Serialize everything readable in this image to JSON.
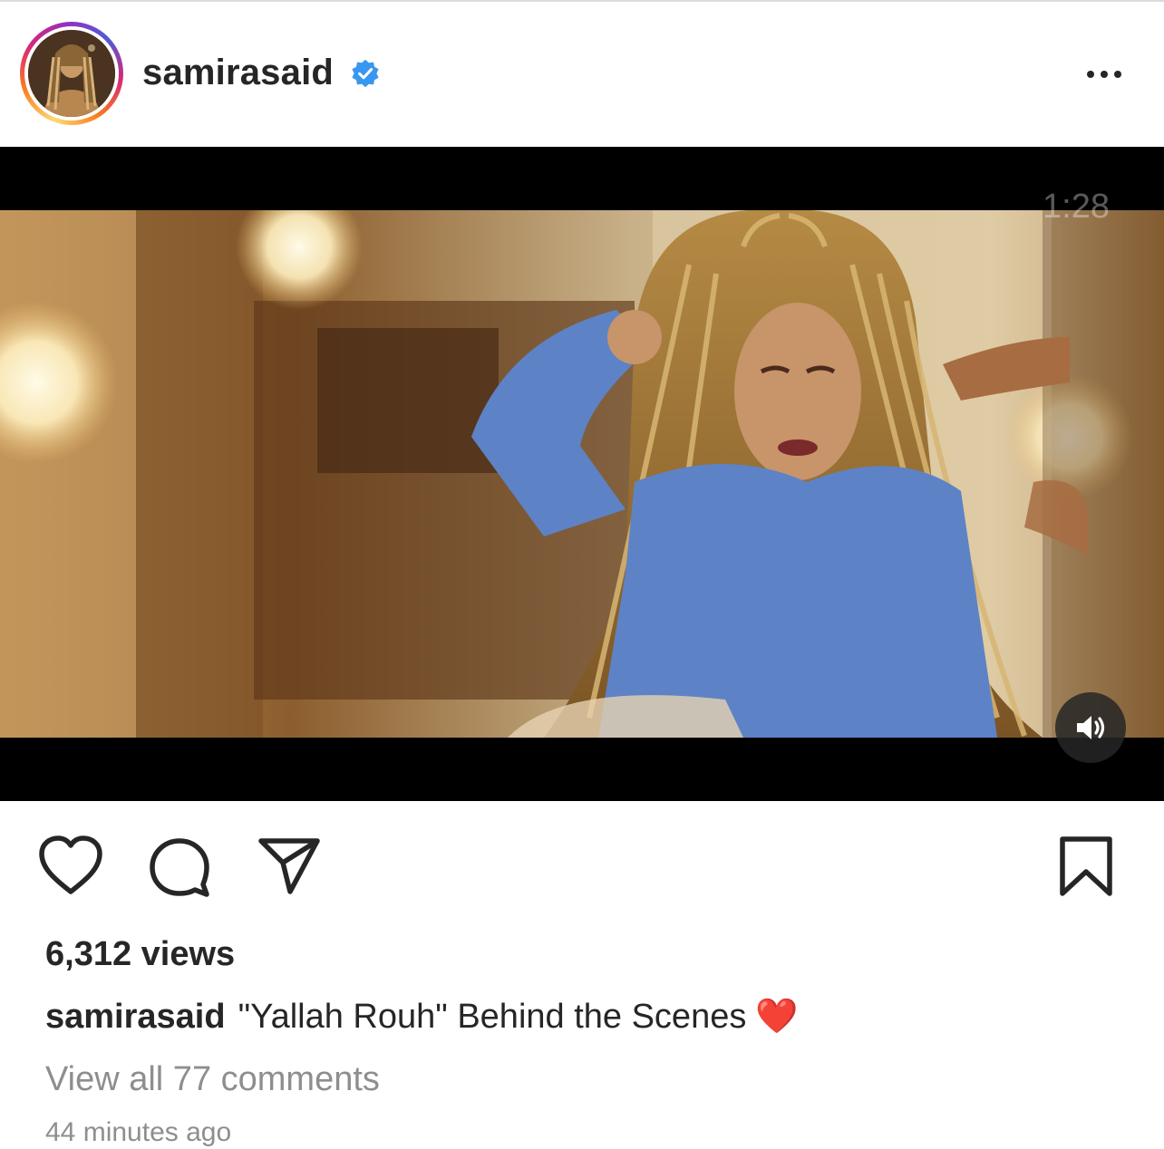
{
  "post": {
    "username": "samirasaid",
    "verified": true,
    "more_icon": "more-horizontal-icon"
  },
  "video": {
    "duration": "1:28",
    "mute_icon": "speaker-on-icon"
  },
  "actions": {
    "like_icon": "heart-outline-icon",
    "comment_icon": "comment-bubble-icon",
    "share_icon": "paper-plane-icon",
    "save_icon": "bookmark-outline-icon"
  },
  "stats": {
    "views": "6,312 views"
  },
  "caption": {
    "username": "samirasaid",
    "text": "\"Yallah Rouh\" Behind the Scenes",
    "emoji": "❤️"
  },
  "comments": {
    "view_all": "View all 77 comments"
  },
  "timestamp": "44 minutes ago",
  "colors": {
    "verified_blue": "#3897f0",
    "text_primary": "#262626",
    "text_secondary": "#8e8e8e"
  }
}
